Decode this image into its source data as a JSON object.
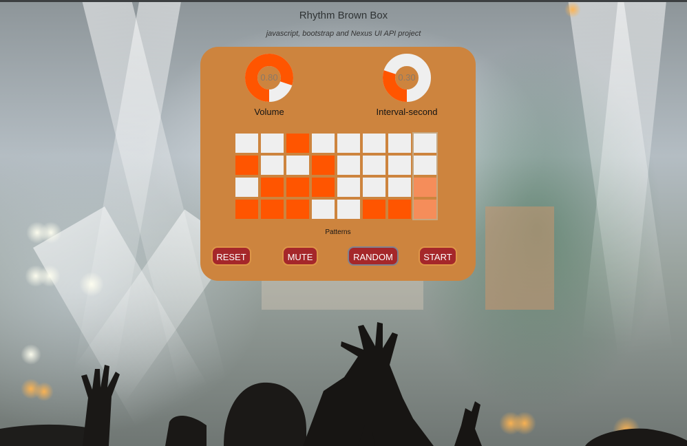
{
  "header": {
    "title": "Rhythm Brown Box",
    "subtitle": "javascript, bootstrap and Nexus UI API project"
  },
  "controls": {
    "volume": {
      "label": "Volume",
      "display": "0.80",
      "value": 0.8
    },
    "interval": {
      "label": "Interval-second",
      "display": "0.30",
      "value": 0.3
    }
  },
  "sequencer": {
    "label": "Patterns",
    "rows": 4,
    "columns": 8,
    "current_column": 7,
    "pattern": [
      [
        0,
        0,
        1,
        0,
        0,
        0,
        0,
        0
      ],
      [
        1,
        0,
        0,
        1,
        0,
        0,
        0,
        0
      ],
      [
        0,
        1,
        1,
        1,
        0,
        0,
        0,
        1
      ],
      [
        1,
        1,
        1,
        0,
        0,
        1,
        1,
        1
      ]
    ]
  },
  "buttons": {
    "reset": "RESET",
    "mute": "MUTE",
    "random": "RANDOM",
    "start": "START"
  },
  "colors": {
    "panel": "#cd843e",
    "active": "#ff5500",
    "inactive": "#efefef",
    "button": "#a5272a"
  }
}
